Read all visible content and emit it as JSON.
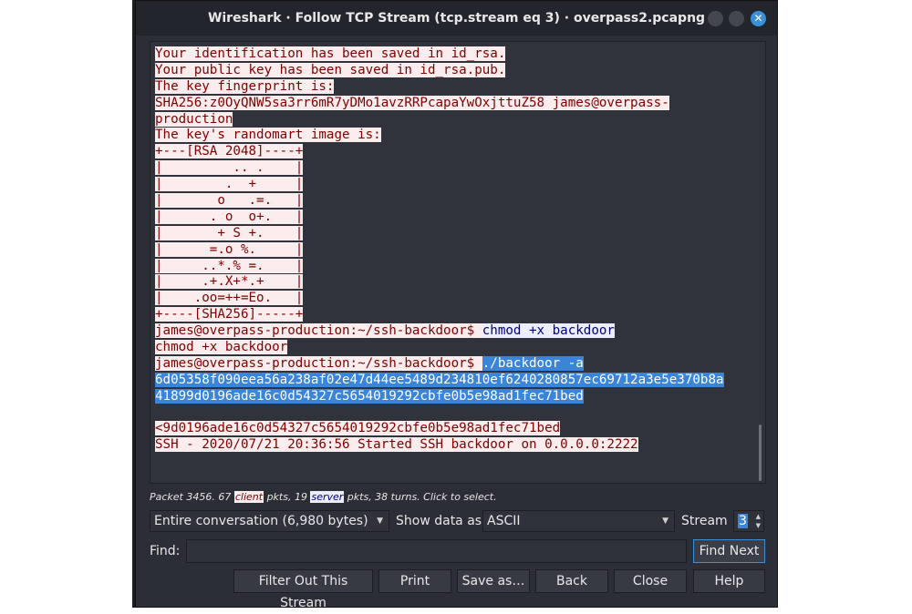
{
  "window": {
    "title": "Wireshark · Follow TCP Stream (tcp.stream eq 3) · overpass2.pcapng",
    "close_glyph": "✕"
  },
  "stream_lines": [
    [
      {
        "t": "c",
        "text": "Your identification has been saved in id_rsa."
      }
    ],
    [
      {
        "t": "c",
        "text": "Your public key has been saved in id_rsa.pub."
      }
    ],
    [
      {
        "t": "c",
        "text": "The key fingerprint is:"
      }
    ],
    [
      {
        "t": "c",
        "text": "SHA256:z0OyQNW5sa3rr6mR7yDMo1avzRRPcapaYwOxjttuZ58 james@overpass-"
      }
    ],
    [
      {
        "t": "c",
        "text": "production"
      }
    ],
    [
      {
        "t": "c",
        "text": "The key's randomart image is:"
      }
    ],
    [
      {
        "t": "c",
        "text": "+---[RSA 2048]----+"
      }
    ],
    [
      {
        "t": "c",
        "text": "|         .. .    |"
      }
    ],
    [
      {
        "t": "c",
        "text": "|        .  +     |"
      }
    ],
    [
      {
        "t": "c",
        "text": "|       o   .=.   |"
      }
    ],
    [
      {
        "t": "c",
        "text": "|      . o  o+.   |"
      }
    ],
    [
      {
        "t": "c",
        "text": "|       + S +.    |"
      }
    ],
    [
      {
        "t": "c",
        "text": "|      =.o %.     |"
      }
    ],
    [
      {
        "t": "c",
        "text": "|     ..*.% =.    |"
      }
    ],
    [
      {
        "t": "c",
        "text": "|     .+.X+*.+    |"
      }
    ],
    [
      {
        "t": "c",
        "text": "|    .oo=++=Eo.   |"
      }
    ],
    [
      {
        "t": "c",
        "text": "+----[SHA256]-----+"
      }
    ],
    [
      {
        "t": "c",
        "text": "james@overpass-production:~/ssh-backdoor$ "
      },
      {
        "t": "s",
        "text": "chmod +x backdoor"
      }
    ],
    [
      {
        "t": "c",
        "text": "chmod +x backdoor"
      }
    ],
    [
      {
        "t": "c",
        "text": "james@overpass-production:~/ssh-backdoor$ "
      },
      {
        "t": "sel",
        "text": "./backdoor -a"
      }
    ],
    [
      {
        "t": "sel",
        "text": "6d05358f090eea56a238af02e47d44ee5489d234810ef6240280857ec69712a3e5e370b8a"
      }
    ],
    [
      {
        "t": "sel",
        "text": "41899d0196ade16c0d54327c5654019292cbfe0b5e98ad1fec71bed"
      }
    ],
    [],
    [
      {
        "t": "c",
        "text": "<9d0196ade16c0d54327c5654019292cbfe0b5e98ad1fec71bed"
      }
    ],
    [
      {
        "t": "c",
        "text": "SSH - 2020/07/21 20:36:56 Started SSH backdoor on 0.0.0.0:2222"
      }
    ]
  ],
  "info": {
    "prefix": "Packet 3456. 67 ",
    "client_tag": "client",
    "middle": " pkts, 19 ",
    "server_tag": "server",
    "suffix": " pkts, 38 turns. Click to select."
  },
  "controls": {
    "conversation_select": "Entire conversation (6,980 bytes)",
    "show_data_label": "Show data as",
    "show_data_select": "ASCII",
    "stream_label": "Stream",
    "stream_value": "3",
    "find_label": "Find:",
    "find_value": "",
    "find_next": "Find Next"
  },
  "buttons": {
    "filter_out": "Filter Out This Stream",
    "print": "Print",
    "save_as": "Save as…",
    "back": "Back",
    "close": "Close",
    "help": "Help"
  },
  "colors": {
    "client_bg": "#fbeded",
    "client_fg": "#7f0000",
    "server_bg": "#edeefb",
    "server_fg": "#00007f",
    "selection": "#3a84d9",
    "accent": "#3b8fd8"
  }
}
